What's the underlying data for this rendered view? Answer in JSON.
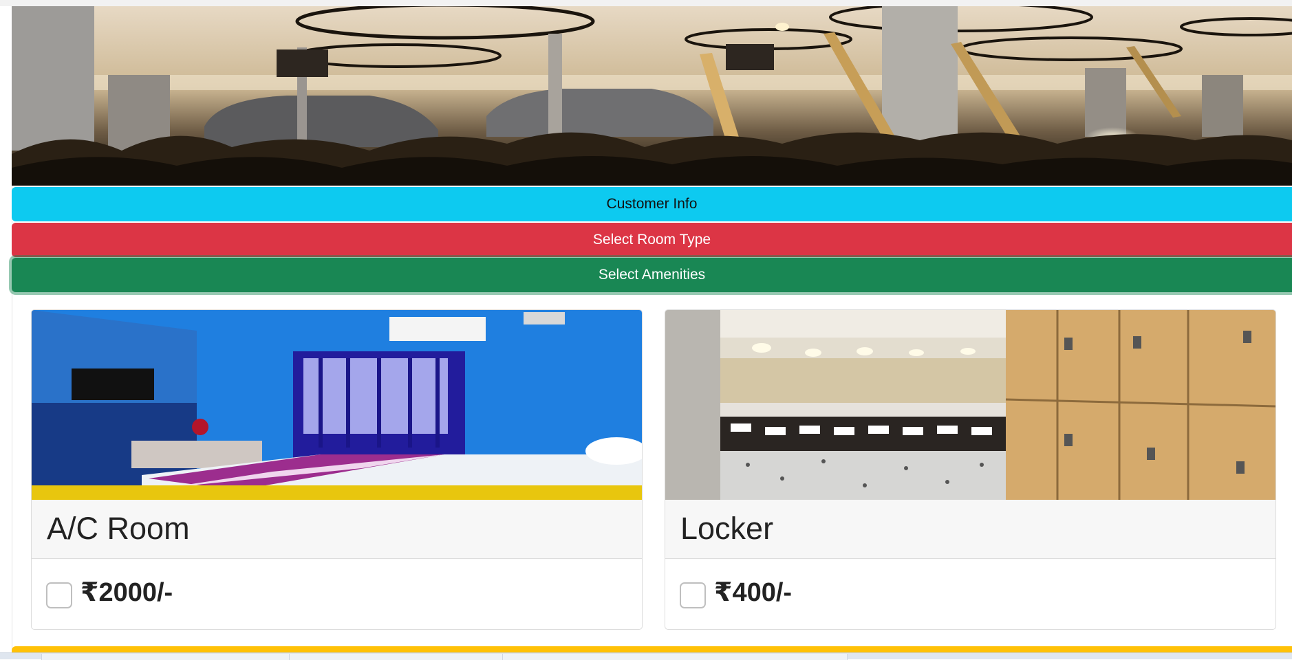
{
  "accordion": {
    "customer_info": "Customer Info",
    "select_room_type": "Select Room Type",
    "select_amenities": "Select Amenities"
  },
  "amenities": [
    {
      "title": "A/C Room",
      "price": "₹2000/-",
      "checked": false
    },
    {
      "title": "Locker",
      "price": "₹400/-",
      "checked": false
    }
  ],
  "colors": {
    "customer_info": "#0dcaf0",
    "select_room_type": "#dc3545",
    "select_amenities": "#198754",
    "next_section": "#ffc107"
  }
}
